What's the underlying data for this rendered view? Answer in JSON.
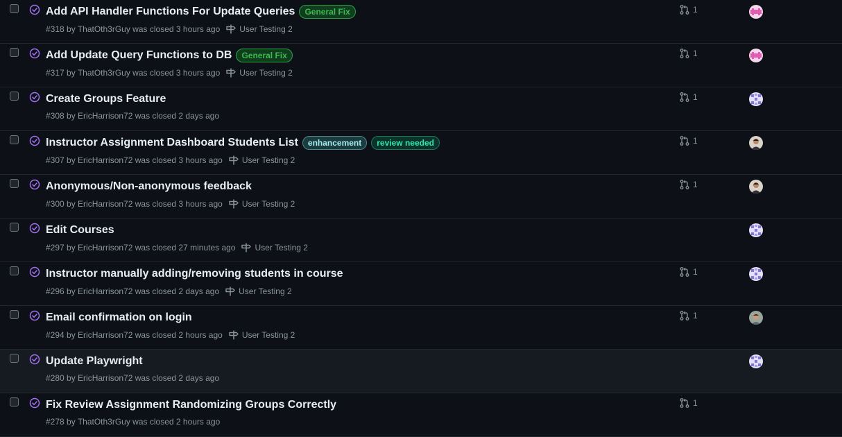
{
  "issues": [
    {
      "title": "Add API Handler Functions For Update Queries",
      "labels": [
        {
          "text": "General Fix",
          "fg": "#3fb950",
          "bg": "#0f3d1e",
          "border": "#2ea043"
        }
      ],
      "meta": "#318 by ThatOth3rGuy was closed 3 hours ago",
      "milestone": "User Testing 2",
      "prs": "1",
      "avatar": "pink"
    },
    {
      "title": "Add Update Query Functions to DB",
      "labels": [
        {
          "text": "General Fix",
          "fg": "#3fb950",
          "bg": "#0f3d1e",
          "border": "#2ea043"
        }
      ],
      "meta": "#317 by ThatOth3rGuy was closed 3 hours ago",
      "milestone": "User Testing 2",
      "prs": "1",
      "avatar": "pink"
    },
    {
      "title": "Create Groups Feature",
      "labels": [],
      "meta": "#308 by EricHarrison72 was closed 2 days ago",
      "milestone": "",
      "prs": "1",
      "avatar": "purple"
    },
    {
      "title": "Instructor Assignment Dashboard Students List",
      "labels": [
        {
          "text": "enhancement",
          "fg": "#a2eeef",
          "bg": "#1c3b3f",
          "border": "#4a8a8f"
        },
        {
          "text": "review needed",
          "fg": "#2ee6b0",
          "bg": "#0b3329",
          "border": "#1a7a5c"
        }
      ],
      "meta": "#307 by EricHarrison72 was closed 3 hours ago",
      "milestone": "User Testing 2",
      "prs": "1",
      "avatar": "photo"
    },
    {
      "title": "Anonymous/Non-anonymous feedback",
      "labels": [],
      "meta": "#300 by EricHarrison72 was closed 3 hours ago",
      "milestone": "User Testing 2",
      "prs": "1",
      "avatar": "photo"
    },
    {
      "title": "Edit Courses",
      "labels": [],
      "meta": "#297 by EricHarrison72 was closed 27 minutes ago",
      "milestone": "User Testing 2",
      "prs": "",
      "avatar": "purple"
    },
    {
      "title": "Instructor manually adding/removing students in course",
      "labels": [],
      "meta": "#296 by EricHarrison72 was closed 2 days ago",
      "milestone": "User Testing 2",
      "prs": "1",
      "avatar": "purple"
    },
    {
      "title": "Email confirmation on login",
      "labels": [],
      "meta": "#294 by EricHarrison72 was closed 2 hours ago",
      "milestone": "User Testing 2",
      "prs": "1",
      "avatar": "photo2"
    },
    {
      "title": "Update Playwright",
      "labels": [],
      "meta": "#280 by EricHarrison72 was closed 2 days ago",
      "milestone": "",
      "prs": "",
      "avatar": "purple"
    },
    {
      "title": "Fix Review Assignment Randomizing Groups Correctly",
      "labels": [],
      "meta": "#278 by ThatOth3rGuy was closed 2 hours ago",
      "milestone": "",
      "prs": "1",
      "avatar": ""
    }
  ],
  "colors": {
    "closed_icon": "#a371f7",
    "meta": "#8b949e",
    "hover_row_index": 8
  }
}
